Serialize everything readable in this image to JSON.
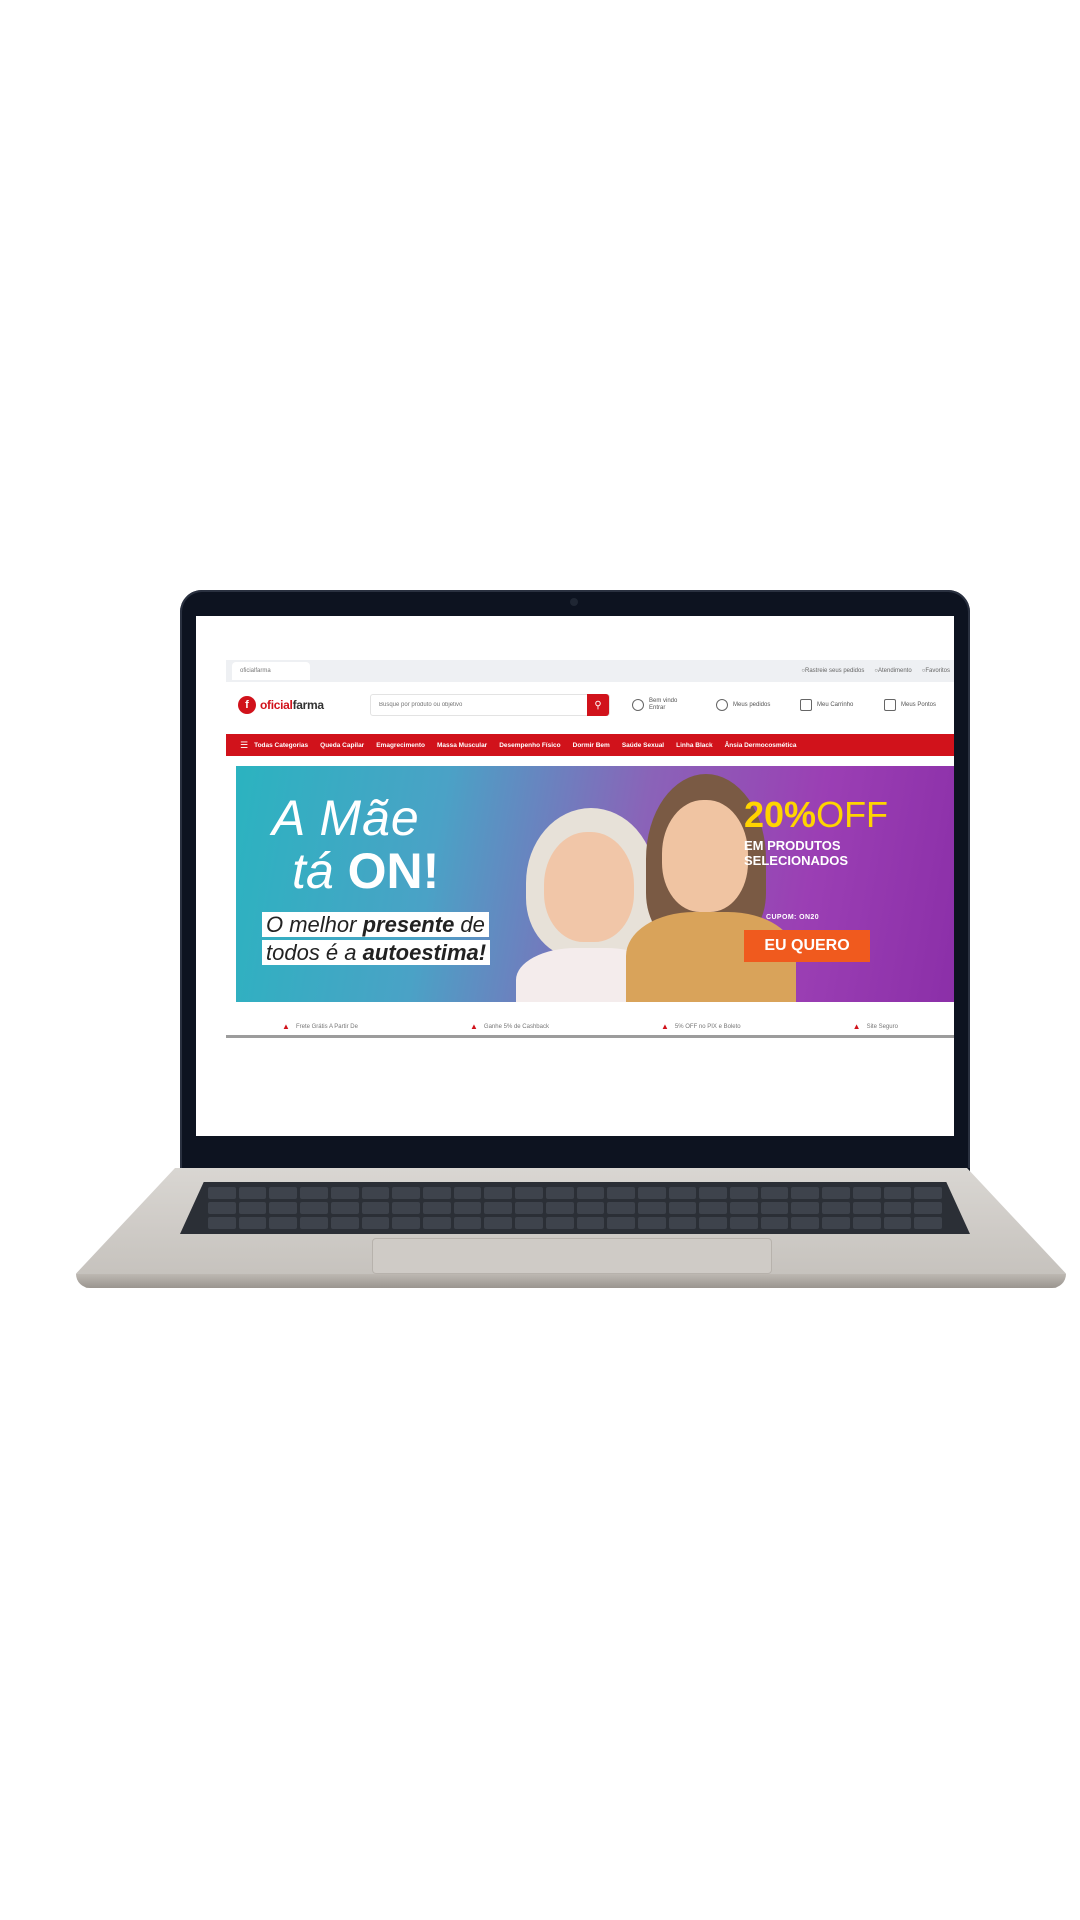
{
  "browser": {
    "tab_label": "oficialfarma",
    "top_links": [
      "Rastreie seus pedidos",
      "Atendimento",
      "Favoritos"
    ]
  },
  "header": {
    "logo_prefix": "oficial",
    "logo_suffix": "farma",
    "search_placeholder": "Busque por produto ou objetivo",
    "actions": [
      {
        "label": "Bem vindo Entrar",
        "icon": "user-icon"
      },
      {
        "label": "Meus pedidos",
        "icon": "orders-icon"
      },
      {
        "label": "Meu Carrinho",
        "icon": "cart-icon"
      },
      {
        "label": "Meus Pontos",
        "icon": "points-icon"
      }
    ]
  },
  "nav": {
    "categories": [
      "Todas Categorias",
      "Queda Capilar",
      "Emagrecimento",
      "Massa Muscular",
      "Desempenho Físico",
      "Dormir Bem",
      "Saúde Sexual",
      "Linha Black",
      "Ânsia Dermocosmética"
    ]
  },
  "hero": {
    "title_line1": "A Mãe",
    "title_line2_italic": "tá ",
    "title_line2_bold": "ON!",
    "slogan_line1_pre": "O melhor ",
    "slogan_line1_bold": "presente",
    "slogan_line1_post": " de",
    "slogan_line2_pre": "todos é a ",
    "slogan_line2_bold": "autoestima!",
    "offer_number": "20%",
    "offer_word": "OFF",
    "offer_sub_line1": "EM PRODUTOS",
    "offer_sub_line2": "SELECIONADOS",
    "coupon": "CUPOM: ON20",
    "cta_label": "EU QUERO"
  },
  "benefits": [
    "Frete Grátis A Partir De",
    "Ganhe 5% de Cashback",
    "5% OFF no PIX e Boleto",
    "Site Seguro"
  ],
  "colors": {
    "brand_red": "#d1121b",
    "cta_orange": "#f05a1e",
    "offer_yellow": "#ffd400"
  }
}
